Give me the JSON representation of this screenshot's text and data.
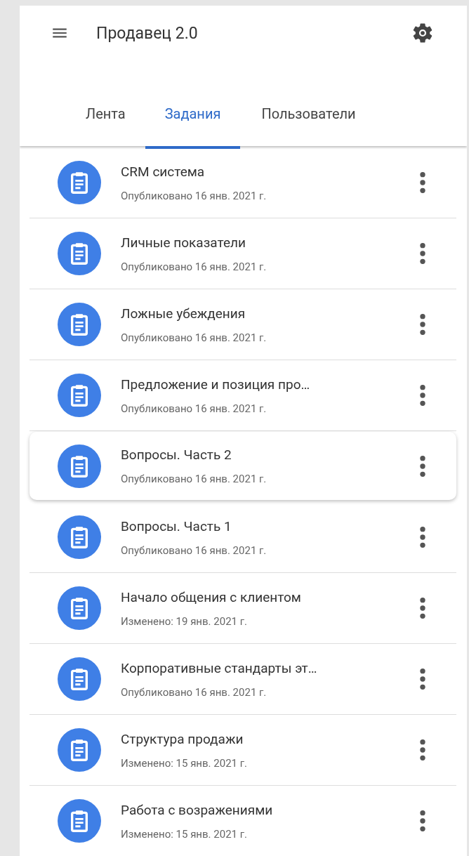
{
  "app_bar": {
    "title": "Продавец 2.0"
  },
  "tabs": [
    {
      "label": "Лента",
      "selected": false
    },
    {
      "label": "Задания",
      "selected": true
    },
    {
      "label": "Пользователи",
      "selected": false
    }
  ],
  "items": [
    {
      "title": "CRM система",
      "subtitle": "Опубликовано 16 янв. 2021 г.",
      "selected": false
    },
    {
      "title": "Личные показатели",
      "subtitle": "Опубликовано 16 янв. 2021 г.",
      "selected": false
    },
    {
      "title": "Ложные убеждения",
      "subtitle": "Опубликовано 16 янв. 2021 г.",
      "selected": false
    },
    {
      "title": "Предложение и позиция про…",
      "subtitle": "Опубликовано 16 янв. 2021 г.",
      "selected": false
    },
    {
      "title": "Вопросы. Часть 2",
      "subtitle": "Опубликовано 16 янв. 2021 г.",
      "selected": true
    },
    {
      "title": "Вопросы. Часть 1",
      "subtitle": "Опубликовано 16 янв. 2021 г.",
      "selected": false
    },
    {
      "title": "Начало общения с клиентом",
      "subtitle": "Изменено: 19 янв. 2021 г.",
      "selected": false
    },
    {
      "title": "Корпоративные стандарты эт…",
      "subtitle": "Опубликовано 16 янв. 2021 г.",
      "selected": false
    },
    {
      "title": "Структура продажи",
      "subtitle": "Изменено: 15 янв. 2021 г.",
      "selected": false
    },
    {
      "title": "Работа с возражениями",
      "subtitle": "Изменено: 15 янв. 2021 г.",
      "selected": false
    }
  ]
}
